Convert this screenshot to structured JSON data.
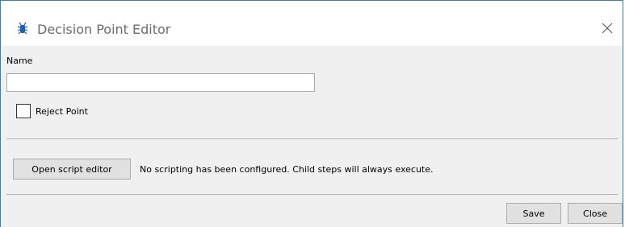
{
  "window": {
    "title": "Decision Point Editor",
    "title_icon": "bug-icon",
    "close_icon": "close-icon"
  },
  "form": {
    "name_label": "Name",
    "name_value": "",
    "name_placeholder": "",
    "reject_point_label": "Reject Point",
    "reject_point_checked": false
  },
  "script": {
    "open_button_label": "Open script editor",
    "status_text": "No scripting has been configured.  Child steps will always execute."
  },
  "footer": {
    "save_label": "Save",
    "close_label": "Close"
  },
  "colors": {
    "window_border": "#3c7fb1",
    "dialog_background": "#f0f0f0",
    "button_background": "#e1e1e1",
    "title_text": "#6b6b6b",
    "icon_blue": "#1f5fb5"
  }
}
